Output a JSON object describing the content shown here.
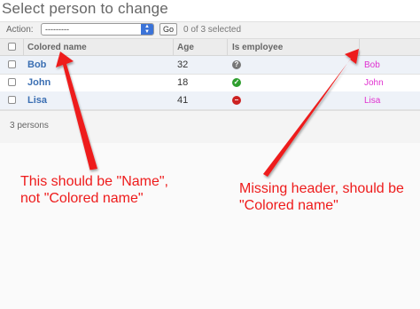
{
  "page": {
    "title": "Select person to change"
  },
  "actions": {
    "label": "Action:",
    "select_value": "---------",
    "go_label": "Go",
    "selected_text": "0 of 3 selected"
  },
  "table": {
    "headers": [
      "Colored name",
      "Age",
      "Is employee"
    ],
    "rows": [
      {
        "name": "Bob",
        "age": "32",
        "employee_icon": "unknown-icon",
        "colored": "Bob",
        "colored_color": "#e030d0"
      },
      {
        "name": "John",
        "age": "18",
        "employee_icon": "yes-icon",
        "colored": "John",
        "colored_color": "#e030d0"
      },
      {
        "name": "Lisa",
        "age": "41",
        "employee_icon": "no-icon",
        "colored": "Lisa",
        "colored_color": "#e030d0"
      }
    ]
  },
  "footer": {
    "count": "3 persons"
  },
  "annotations": [
    {
      "text_line1": "This should be \"Name\",",
      "text_line2": "not \"Colored name\""
    },
    {
      "text_line1": "Missing header, should be",
      "text_line2": "\"Colored name\""
    }
  ],
  "colors": {
    "annotation": "#ee1b1b",
    "link": "#3b6fb3",
    "colored_text": "#e030d0",
    "icon_unknown": "#777777",
    "icon_yes": "#2e9e2e",
    "icon_no": "#cc2222"
  }
}
